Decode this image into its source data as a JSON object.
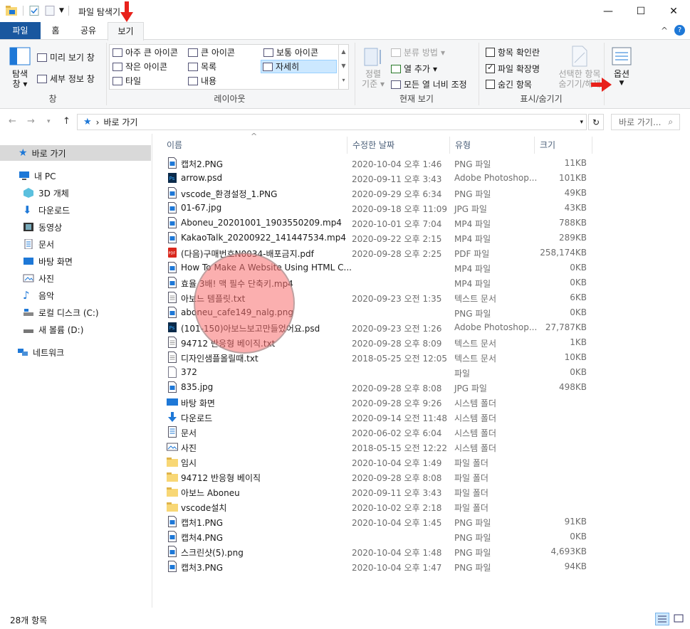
{
  "window": {
    "title": "파일 탐색기",
    "minimize_glyph": "—",
    "maximize_glyph": "☐",
    "close_glyph": "✕"
  },
  "ribbon_tabs": [
    "파일",
    "홈",
    "공유",
    "보기"
  ],
  "ribbon": {
    "panes": {
      "nav_pane_line1": "탐색",
      "nav_pane_line2": "창",
      "preview_pane": "미리 보기 창",
      "details_pane": "세부 정보 창",
      "label": "창"
    },
    "layout": {
      "items": [
        "아주 큰 아이콘",
        "큰 아이콘",
        "보통 아이콘",
        "작은 아이콘",
        "목록",
        "자세히",
        "타일",
        "내용"
      ],
      "selected": "자세히",
      "label": "레이아웃"
    },
    "current_view": {
      "sort_line1": "정렬",
      "sort_line2": "기준",
      "group_by": "분류 방법",
      "add_columns": "열 추가",
      "size_columns": "모든 열 너비 조정",
      "label": "현재 보기"
    },
    "show_hide": {
      "item_checkboxes": "항목 확인란",
      "item_checkboxes_checked": false,
      "file_extensions": "파일 확장명",
      "file_extensions_checked": true,
      "hidden_items": "숨긴 항목",
      "hidden_items_checked": false,
      "hide_selected_line1": "선택한 항목",
      "hide_selected_line2": "숨기기/해제",
      "label": "표시/숨기기"
    },
    "options": "옵션",
    "collapse_glyph": "^",
    "help_glyph": "?"
  },
  "address": {
    "path": "바로 가기",
    "search_placeholder": "바로 가기...",
    "separator": "›"
  },
  "sidebar": {
    "items": [
      {
        "label": "바로 가기",
        "icon": "star-icon",
        "active": true
      },
      {
        "label": "내 PC",
        "icon": "pc-icon"
      },
      {
        "label": "3D 개체",
        "icon": "cube-icon"
      },
      {
        "label": "다운로드",
        "icon": "download-icon"
      },
      {
        "label": "동영상",
        "icon": "video-icon"
      },
      {
        "label": "문서",
        "icon": "document-icon"
      },
      {
        "label": "바탕 화면",
        "icon": "desktop-icon"
      },
      {
        "label": "사진",
        "icon": "picture-icon"
      },
      {
        "label": "음악",
        "icon": "music-icon"
      },
      {
        "label": "로컬 디스크 (C:)",
        "icon": "disk-icon"
      },
      {
        "label": "새 볼륨 (D:)",
        "icon": "drive-icon"
      },
      {
        "label": "네트워크",
        "icon": "network-icon"
      }
    ]
  },
  "columns": [
    "이름",
    "수정한 날짜",
    "유형",
    "크기"
  ],
  "files": [
    {
      "name": "캡처2.PNG",
      "date": "2020-10-04 오후 1:46",
      "type": "PNG 파일",
      "size": "11KB",
      "icon": "image"
    },
    {
      "name": "arrow.psd",
      "date": "2020-09-11 오후 3:43",
      "type": "Adobe Photoshop...",
      "size": "101KB",
      "icon": "psd"
    },
    {
      "name": "vscode_환경설정_1.PNG",
      "date": "2020-09-29 오후 6:34",
      "type": "PNG 파일",
      "size": "49KB",
      "icon": "image"
    },
    {
      "name": "01-67.jpg",
      "date": "2020-09-18 오후 11:09",
      "type": "JPG 파일",
      "size": "43KB",
      "icon": "image"
    },
    {
      "name": "Aboneu_20201001_1903550209.mp4",
      "date": "2020-10-01 오후 7:04",
      "type": "MP4 파일",
      "size": "788KB",
      "icon": "image"
    },
    {
      "name": "KakaoTalk_20200922_141447534.mp4",
      "date": "2020-09-22 오후 2:15",
      "type": "MP4 파일",
      "size": "289KB",
      "icon": "image"
    },
    {
      "name": "(다음)구매번호N0034-배포금지.pdf",
      "date": "2020-09-28 오후 2:25",
      "type": "PDF 파일",
      "size": "258,174KB",
      "icon": "pdf"
    },
    {
      "name": "How To Make A Website Using HTML C...",
      "date": "",
      "type": "MP4 파일",
      "size": "0KB",
      "icon": "image"
    },
    {
      "name": "효율 3배! 맥 필수 단축키.mp4",
      "date": "",
      "type": "MP4 파일",
      "size": "0KB",
      "icon": "image"
    },
    {
      "name": "아보느 템플릿.txt",
      "date": "2020-09-23 오전 1:35",
      "type": "텍스트 문서",
      "size": "6KB",
      "icon": "text"
    },
    {
      "name": "aboneu_cafe149_nalg.png",
      "date": "",
      "type": "PNG 파일",
      "size": "0KB",
      "icon": "image"
    },
    {
      "name": "(101-150)아보느보고만들었어요.psd",
      "date": "2020-09-23 오전 1:26",
      "type": "Adobe Photoshop...",
      "size": "27,787KB",
      "icon": "psd"
    },
    {
      "name": "94712 반응형 베이직.txt",
      "date": "2020-09-28 오후 8:09",
      "type": "텍스트 문서",
      "size": "1KB",
      "icon": "text"
    },
    {
      "name": "디자인샘플올릴때.txt",
      "date": "2018-05-25 오전 12:05",
      "type": "텍스트 문서",
      "size": "10KB",
      "icon": "text"
    },
    {
      "name": "372",
      "date": "",
      "type": "파일",
      "size": "0KB",
      "icon": "blank"
    },
    {
      "name": "835.jpg",
      "date": "2020-09-28 오후 8:08",
      "type": "JPG 파일",
      "size": "498KB",
      "icon": "image"
    },
    {
      "name": "바탕 화면",
      "date": "2020-09-28 오후 9:26",
      "type": "시스템 폴더",
      "size": "",
      "icon": "desktop"
    },
    {
      "name": "다운로드",
      "date": "2020-09-14 오전 11:48",
      "type": "시스템 폴더",
      "size": "",
      "icon": "download"
    },
    {
      "name": "문서",
      "date": "2020-06-02 오후 6:04",
      "type": "시스템 폴더",
      "size": "",
      "icon": "document"
    },
    {
      "name": "사진",
      "date": "2018-05-15 오전 12:22",
      "type": "시스템 폴더",
      "size": "",
      "icon": "picture"
    },
    {
      "name": "임시",
      "date": "2020-10-04 오후 1:49",
      "type": "파일 폴더",
      "size": "",
      "icon": "folder"
    },
    {
      "name": "94712 반응형 베이직",
      "date": "2020-09-28 오후 8:08",
      "type": "파일 폴더",
      "size": "",
      "icon": "folder"
    },
    {
      "name": "아보느 Aboneu",
      "date": "2020-09-11 오후 3:43",
      "type": "파일 폴더",
      "size": "",
      "icon": "folder"
    },
    {
      "name": "vscode설치",
      "date": "2020-10-02 오후 2:18",
      "type": "파일 폴더",
      "size": "",
      "icon": "folder"
    },
    {
      "name": "캡처1.PNG",
      "date": "2020-10-04 오후 1:45",
      "type": "PNG 파일",
      "size": "91KB",
      "icon": "image"
    },
    {
      "name": "캡처4.PNG",
      "date": "",
      "type": "PNG 파일",
      "size": "0KB",
      "icon": "image"
    },
    {
      "name": "스크린샷(5).png",
      "date": "2020-10-04 오후 1:48",
      "type": "PNG 파일",
      "size": "4,693KB",
      "icon": "image"
    },
    {
      "name": "캡처3.PNG",
      "date": "2020-10-04 오후 1:47",
      "type": "PNG 파일",
      "size": "94KB",
      "icon": "image"
    }
  ],
  "status": {
    "item_count": "28개 항목"
  },
  "colors": {
    "file_tab": "#19579f",
    "selection": "#cce8ff",
    "annotation_red": "#e8211b",
    "folder": "#f8d775",
    "accent_blue": "#1e78d7"
  }
}
